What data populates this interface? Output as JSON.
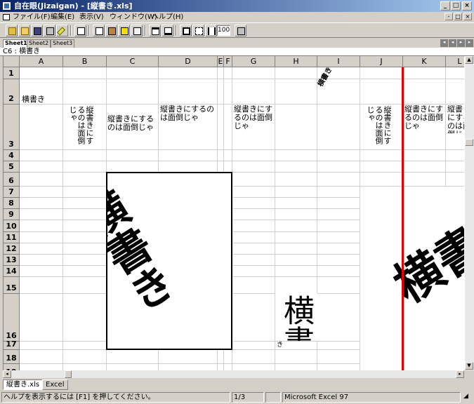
{
  "window": {
    "title": "自在眼(Jizaigan) - [縦書き.xls]",
    "buttons": [
      "_",
      "□",
      "×"
    ]
  },
  "menu": {
    "items": [
      "ファイル(F)",
      "編集(E)",
      "表示(V)",
      "ウィンドウ(W)",
      "ヘルプ(H)"
    ],
    "mdi_buttons": [
      "-",
      "□",
      "×"
    ]
  },
  "toolbar": {
    "zoom": "100"
  },
  "sheets": {
    "tabs": [
      "Sheet1",
      "Sheet2",
      "Sheet3"
    ],
    "active": "Sheet1"
  },
  "formula": {
    "text": "C6 : 横書き"
  },
  "grid": {
    "columns": [
      "A",
      "B",
      "C",
      "D",
      "E",
      "F",
      "G",
      "H",
      "I",
      "J",
      "K",
      "L"
    ],
    "rows": [
      "1",
      "2",
      "3",
      "4",
      "5",
      "6",
      "7",
      "8",
      "9",
      "10",
      "11",
      "12",
      "13",
      "14",
      "15",
      "16",
      "17",
      "18",
      "19"
    ]
  },
  "cells": {
    "a2": "横書き",
    "b3": "縦書きにするのは面倒じゃ",
    "c3": "縦書きにするのは面倒じゃ",
    "d3": "縦書きにするのは面倒じゃ",
    "g3": "縦書きにするのは面倒じゃ",
    "i2": "横書き",
    "j3": "縦書きにするのは面倒じゃ",
    "k3": "縦書きにするのは面倒じゃ",
    "l3": "縦書きにするのは面倒じゃ",
    "big_c": "横書き",
    "big_h": "横書",
    "h17": "き",
    "big_k": "横書"
  },
  "window_tabs": [
    "縦書き.xls",
    "Excel"
  ],
  "status": {
    "help": "ヘルプを表示するには [F1] を押してください。",
    "page": "1/3",
    "app": "Microsoft Excel 97"
  },
  "colors": {
    "title_start": "#0a246a",
    "title_end": "#a6caf0",
    "red_line": "#e00000"
  }
}
